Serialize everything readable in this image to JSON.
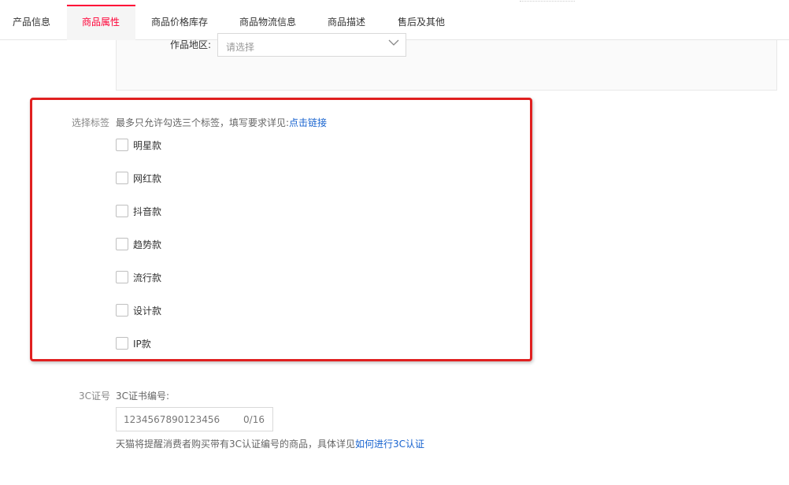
{
  "tabs": [
    {
      "label": "产品信息",
      "active": false
    },
    {
      "label": "商品属性",
      "active": true
    },
    {
      "label": "商品价格库存",
      "active": false
    },
    {
      "label": "商品物流信息",
      "active": false
    },
    {
      "label": "商品描述",
      "active": false
    },
    {
      "label": "售后及其他",
      "active": false
    }
  ],
  "region": {
    "label": "作品地区:",
    "placeholder": "请选择"
  },
  "tags": {
    "label": "选择标签",
    "hint": "最多只允许勾选三个标签，填写要求详见:",
    "hint_link": "点击链接",
    "options": [
      {
        "label": "明星款",
        "checked": false
      },
      {
        "label": "网红款",
        "checked": false
      },
      {
        "label": "抖音款",
        "checked": false
      },
      {
        "label": "趋势款",
        "checked": false
      },
      {
        "label": "流行款",
        "checked": false
      },
      {
        "label": "设计款",
        "checked": false
      },
      {
        "label": "IP款",
        "checked": false
      }
    ]
  },
  "cert": {
    "label": "3C证号",
    "sub_label": "3C证书编号:",
    "value": "1234567890123456",
    "counter": "0/16",
    "note": "天猫将提醒消费者购买带有3C认证编号的商品，具体详见",
    "note_link": "如何进行3C认证"
  },
  "colors": {
    "accent": "#ff0036",
    "link": "#1662cf",
    "highlight_border": "#e02020"
  },
  "icons": {
    "region_dropdown": "chevron-down-icon"
  }
}
